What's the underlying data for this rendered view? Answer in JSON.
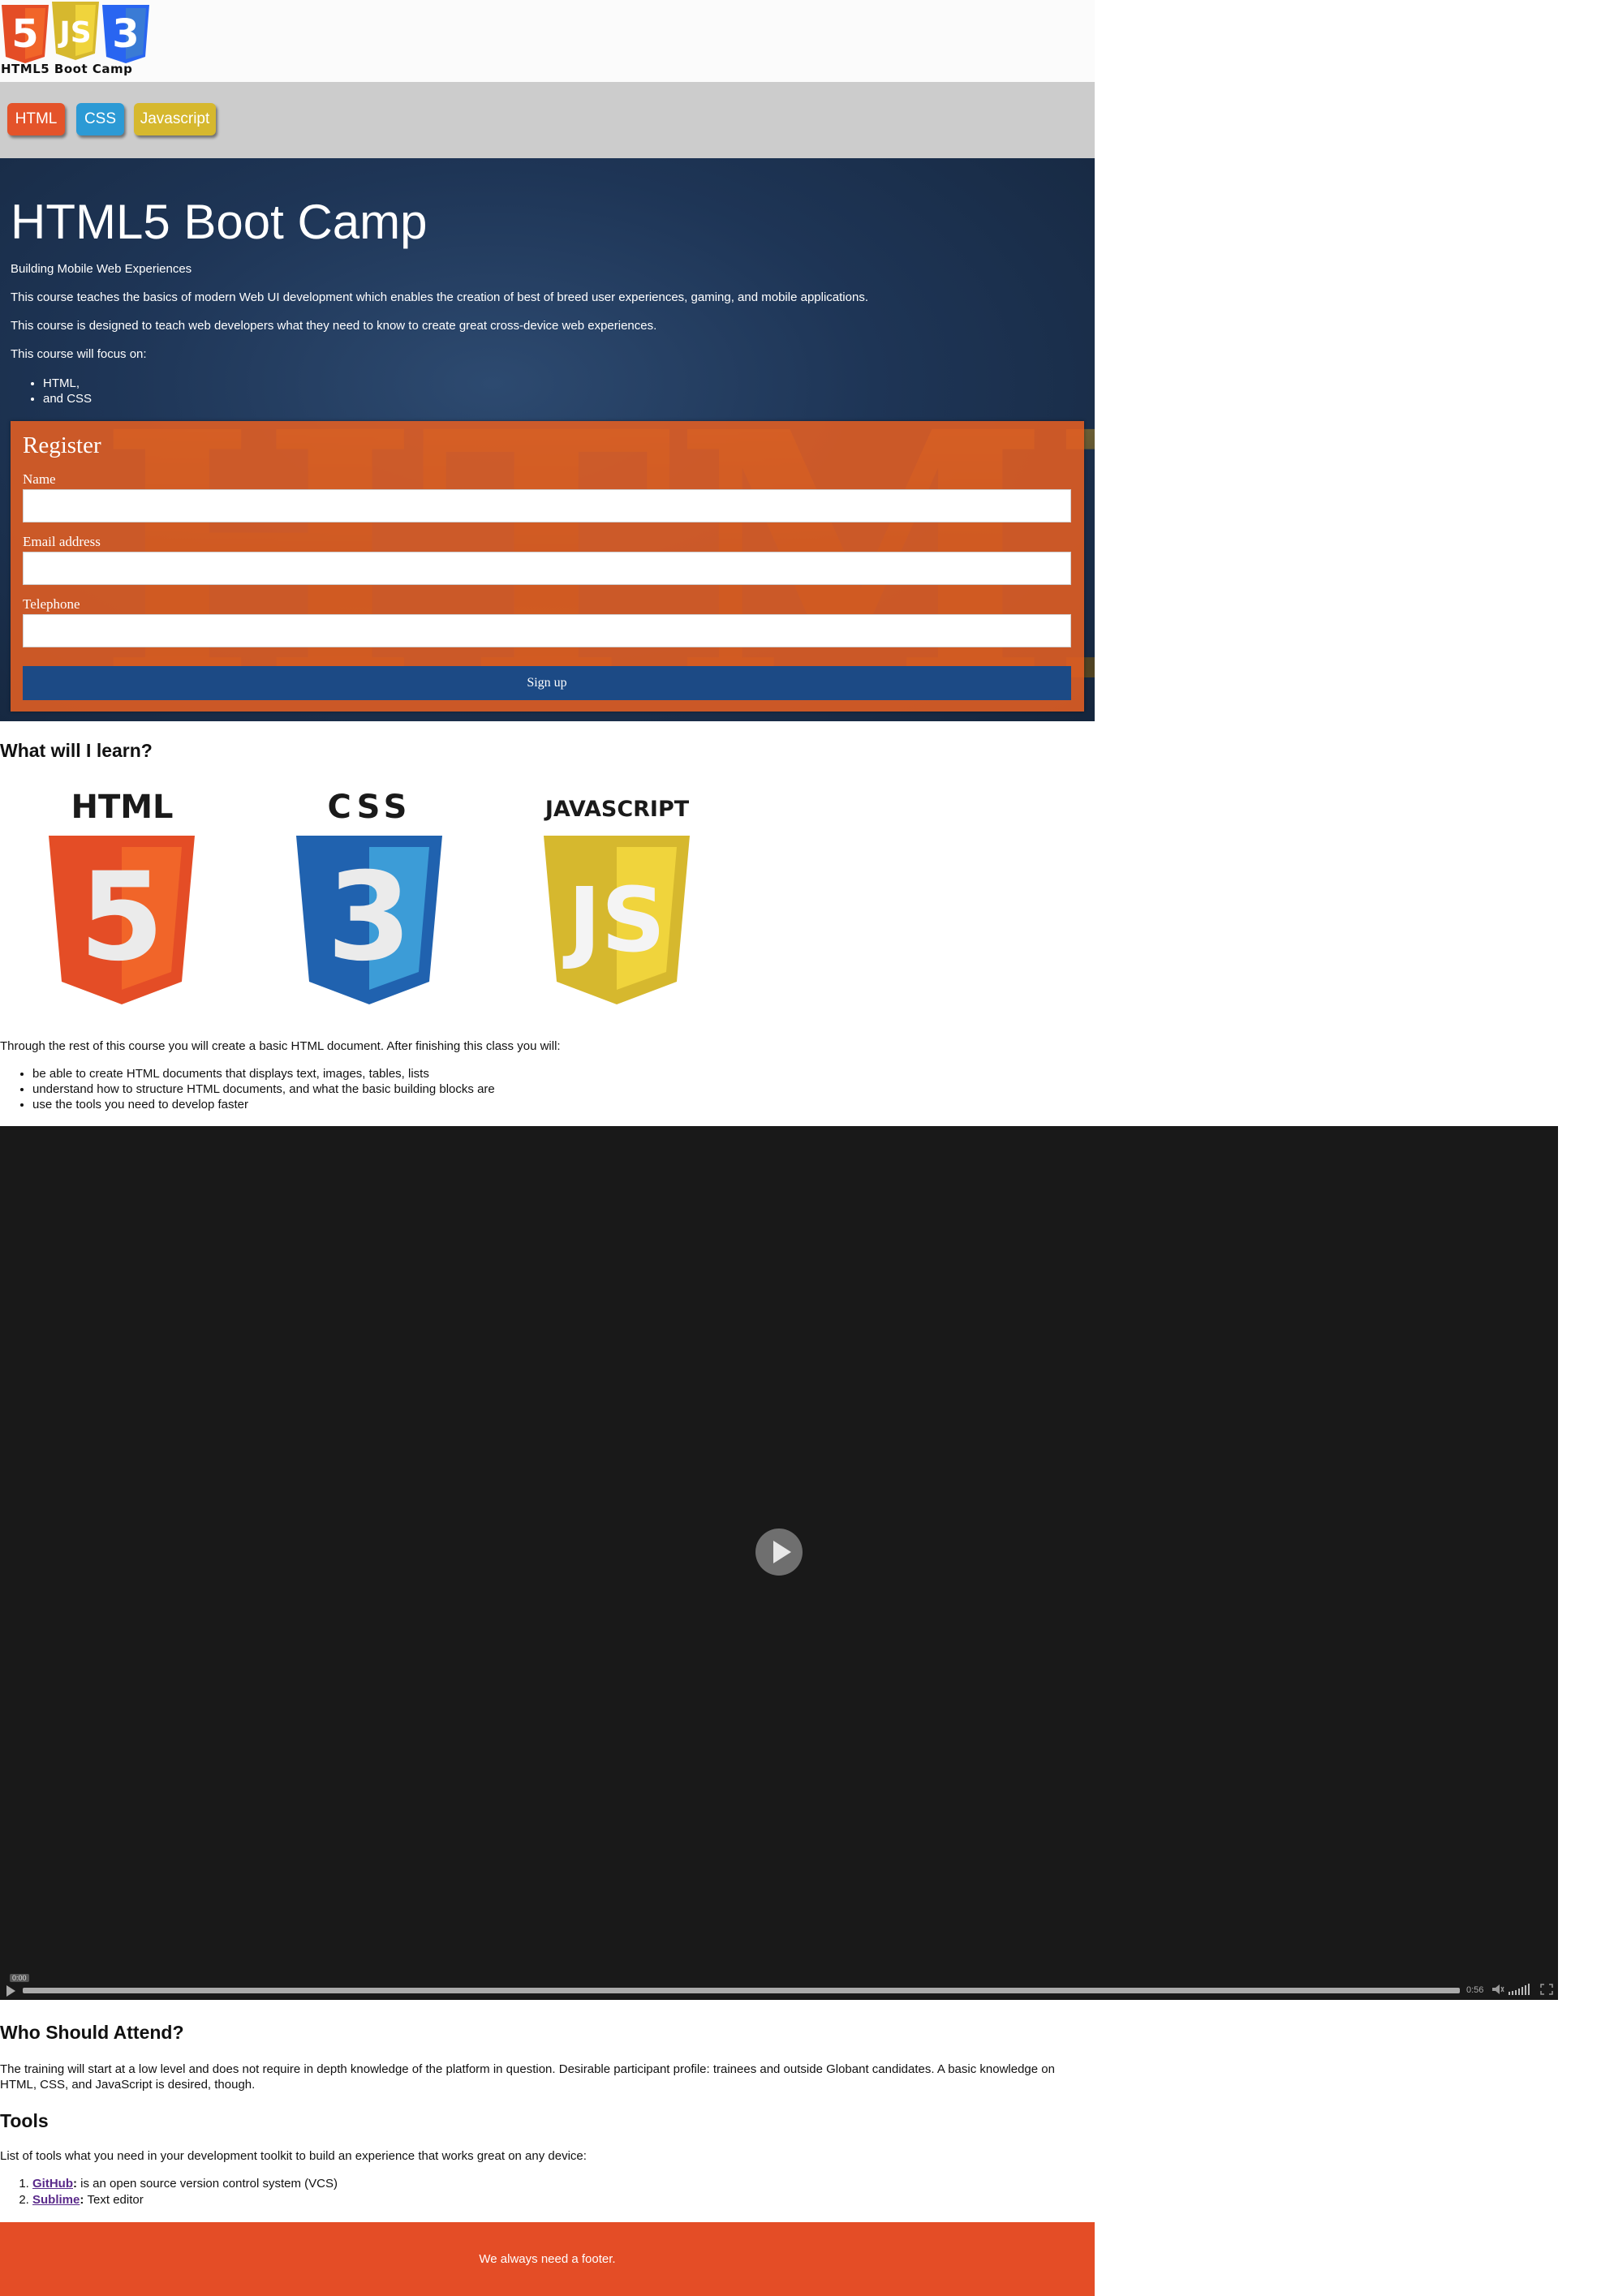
{
  "header": {
    "logo_text": "HTML5 Boot Camp",
    "logo_glyphs": [
      "5",
      "JS",
      "3"
    ]
  },
  "nav": {
    "items": [
      {
        "label": "HTML",
        "color": "#e4532a"
      },
      {
        "label": "CSS",
        "color": "#2c9ad5"
      },
      {
        "label": "Javascript",
        "color": "#d6b82e"
      }
    ]
  },
  "hero": {
    "title": "HTML5 Boot Camp",
    "subtitle": "Building Mobile Web Experiences",
    "paragraphs": [
      "This course teaches the basics of modern Web UI development which enables the creation of best of breed user experiences, gaming, and mobile applications.",
      "This course is designed to teach web developers what they need to know to create great cross-device web experiences.",
      "This course will focus on:"
    ],
    "focus_items": [
      "HTML,",
      "and CSS"
    ],
    "bg_watermark": "HTML5"
  },
  "register": {
    "title": "Register",
    "fields": [
      {
        "label": "Name",
        "value": ""
      },
      {
        "label": "Email address",
        "value": ""
      },
      {
        "label": "Telephone",
        "value": ""
      }
    ],
    "submit_label": "Sign up"
  },
  "learn": {
    "heading": "What will I learn?",
    "logos": [
      {
        "label": "HTML",
        "glyph": "5",
        "color": "#e44d26"
      },
      {
        "label": "CSS",
        "glyph": "3",
        "color": "#2965f1"
      },
      {
        "label": "JAVASCRIPT",
        "glyph": "JS",
        "color": "#d6b82e"
      }
    ],
    "intro": "Through the rest of this course you will create a basic HTML document. After finishing this class you will:",
    "outcomes": [
      "be able to create HTML documents that displays text, images, tables, lists",
      "understand how to structure HTML documents, and what the basic building blocks are",
      "use the tools you need to develop faster"
    ]
  },
  "video": {
    "current_time": "0:00",
    "duration": "0:56"
  },
  "attend": {
    "heading": "Who Should Attend?",
    "text": "The training will start at a low level and does not require in depth knowledge of the platform in question. Desirable participant profile: trainees and outside Globant candidates. A basic knowledge on HTML, CSS, and JavaScript is desired, though."
  },
  "tools": {
    "heading": "Tools",
    "intro": "List of tools what you need in your development toolkit to build an experience that works great on any device:",
    "items": [
      {
        "name": "GitHub",
        "desc": "is an open source version control system (VCS)"
      },
      {
        "name": "Sublime",
        "desc": "Text editor"
      }
    ]
  },
  "footer": {
    "text": "We always need a footer."
  }
}
